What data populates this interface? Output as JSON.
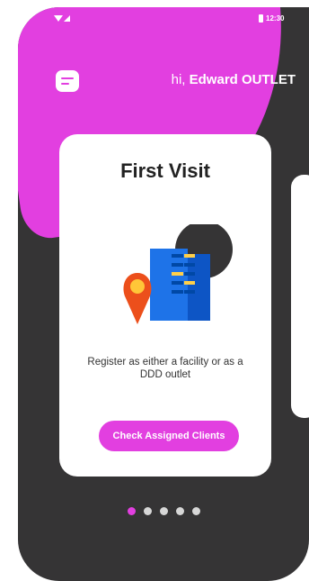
{
  "status_bar": {
    "time": "12:30",
    "icons": [
      "wifi-icon",
      "signal-icon",
      "battery-icon"
    ]
  },
  "header": {
    "menu_icon": "menu-icon",
    "greeting_prefix": "hi, ",
    "user_name": "Edward",
    "user_role": "OUTLET"
  },
  "card": {
    "title": "First Visit",
    "illustration": "building-with-location-pin",
    "description": "Register as either a facility or as a DDD outlet",
    "button_label": "Check Assigned Clients"
  },
  "pagination": {
    "total": 5,
    "active_index": 0
  },
  "colors": {
    "accent": "#e23fe0",
    "background": "#353435",
    "card": "#ffffff",
    "building": "#1e73e8",
    "pin": "#ec4f1b"
  }
}
